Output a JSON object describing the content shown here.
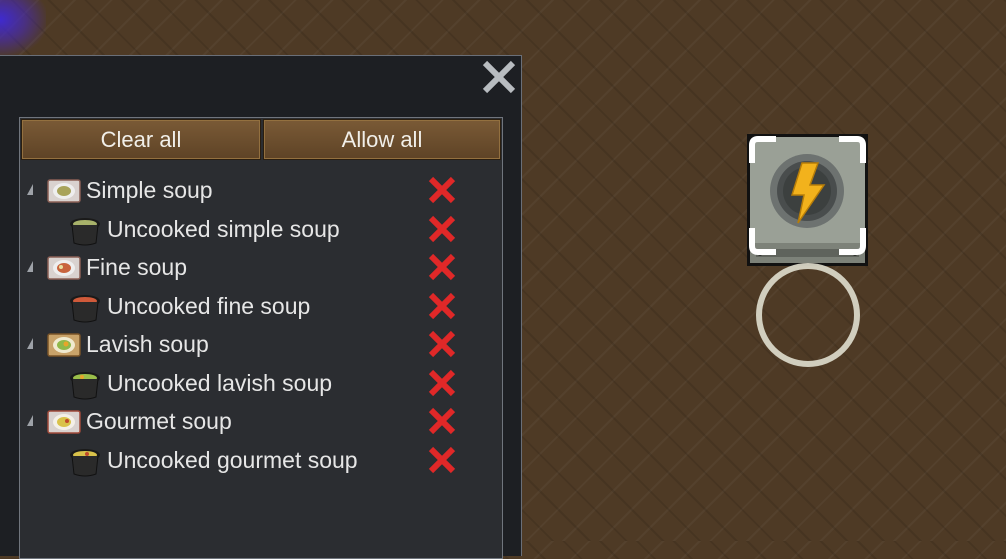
{
  "window": {
    "close_icon": "close-x-icon",
    "buttons": {
      "clear_all": "Clear all",
      "allow_all": "Allow all"
    },
    "tree": [
      {
        "label": "Simple soup",
        "icon": "simple-soup-plate-icon",
        "allowed": false,
        "items": [
          {
            "label": "Uncooked simple soup",
            "icon": "pot-icon",
            "soup_color": "#a8b26a",
            "allowed": false
          }
        ]
      },
      {
        "label": "Fine soup",
        "icon": "fine-soup-plate-icon",
        "allowed": false,
        "items": [
          {
            "label": "Uncooked fine soup",
            "icon": "pot-icon",
            "soup_color": "#d05a3a",
            "allowed": false
          }
        ]
      },
      {
        "label": "Lavish soup",
        "icon": "lavish-soup-plate-icon",
        "allowed": false,
        "items": [
          {
            "label": "Uncooked lavish soup",
            "icon": "pot-icon",
            "soup_color": "#9bbf4a",
            "allowed": false
          }
        ]
      },
      {
        "label": "Gourmet soup",
        "icon": "gourmet-soup-plate-icon",
        "allowed": false,
        "items": [
          {
            "label": "Uncooked gourmet soup",
            "icon": "pot-icon",
            "soup_color": "#d9c24a",
            "allowed": false
          }
        ]
      }
    ],
    "disallowed_icon": "red-x-icon"
  },
  "world": {
    "building_icon": "battery-lightning-icon",
    "selection_ring": "circle-ring"
  },
  "colors": {
    "floor": "#4e3a25",
    "window_bg": "#1d1f23",
    "button_bg": "#6b4d2e",
    "disallowed": "#e02828",
    "lightning": "#f2b21c"
  }
}
